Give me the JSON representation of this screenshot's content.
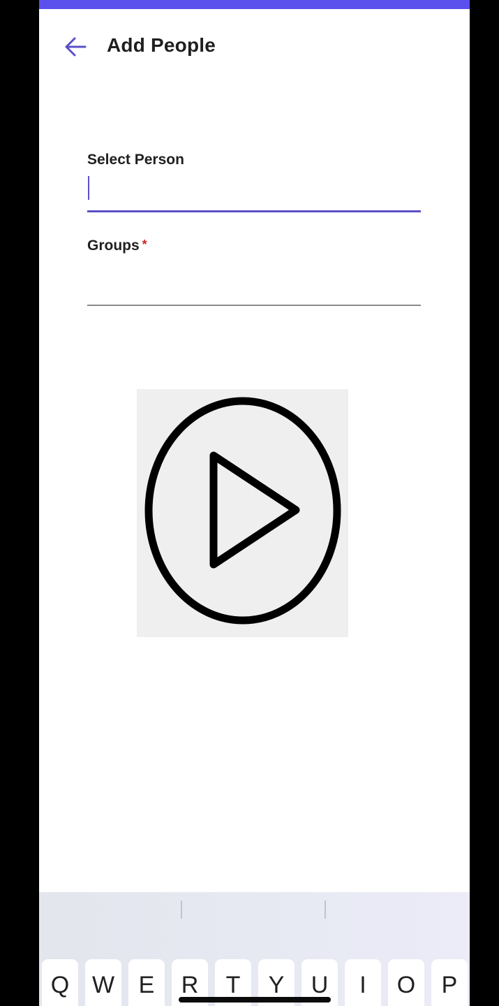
{
  "theme": {
    "accent": "#5b50c8",
    "status_bar": "#5b50ee",
    "text": "#1f1f1f",
    "required": "#c62828",
    "divider": "#8a8a8a"
  },
  "header": {
    "back_icon": "arrow-left-icon",
    "title": "Add People"
  },
  "form": {
    "select_person": {
      "label": "Select Person",
      "value": ""
    },
    "groups": {
      "label": "Groups",
      "required_mark": "*",
      "value": ""
    }
  },
  "media": {
    "icon": "play-circle-icon"
  },
  "keyboard": {
    "keys": [
      "Q",
      "W",
      "E",
      "R",
      "T",
      "Y",
      "U",
      "I",
      "O",
      "P"
    ]
  }
}
